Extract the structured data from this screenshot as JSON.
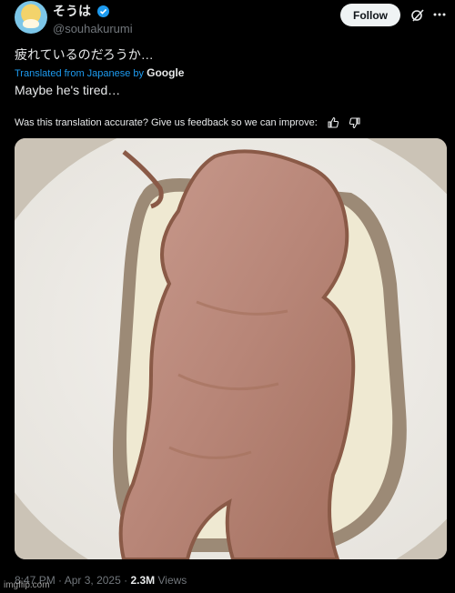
{
  "author": {
    "display_name": "そうは",
    "handle": "@souhakurumi"
  },
  "header": {
    "follow_label": "Follow"
  },
  "post": {
    "original_text": "疲れているのだろうか…",
    "translated_from": "Translated from Japanese by",
    "translator": "Google",
    "translation": "Maybe he's tired…",
    "feedback_prompt": "Was this translation accurate? Give us feedback so we can improve:"
  },
  "meta": {
    "time": "8:47 PM",
    "separator1": "·",
    "date": "Apr 3, 2025",
    "separator2": "·",
    "views_count": "2.3M",
    "views_label": "Views"
  },
  "watermark": "imgflip.com",
  "colors": {
    "background": "#000000",
    "accent": "#1d9bf0",
    "text": "#e7e9ea",
    "muted": "#71767b"
  },
  "icons": [
    "verified-badge-icon",
    "grok-icon",
    "more-icon",
    "thumbs-up-icon",
    "thumbs-down-icon"
  ]
}
